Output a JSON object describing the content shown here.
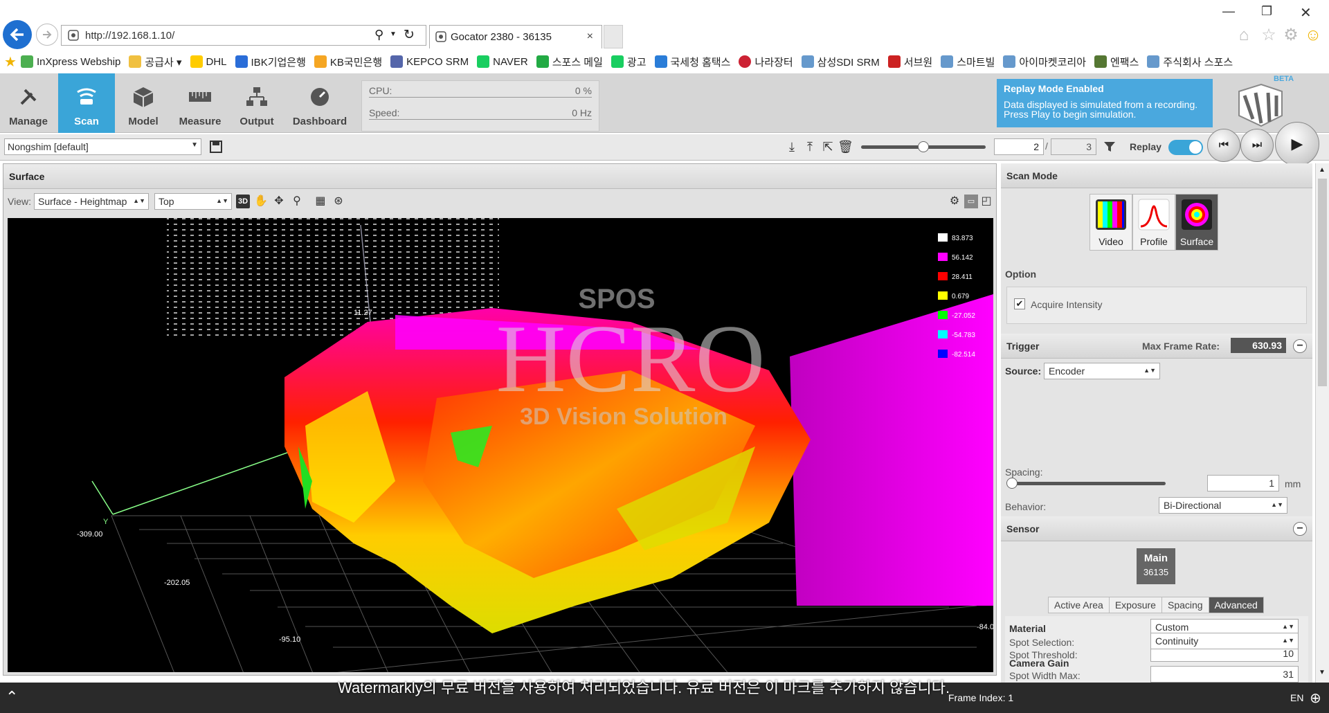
{
  "browser": {
    "url": "http://192.168.1.10/",
    "tab_title": "Gocator 2380 - 36135",
    "tab_close": "×"
  },
  "favorites": [
    {
      "label": "InXpress Webship",
      "color": "#4caf50"
    },
    {
      "label": "공급사 ▾",
      "color": "#f0c040"
    },
    {
      "label": "DHL",
      "color": "#ffcc00"
    },
    {
      "label": "IBK기업은행",
      "color": "#2a6dd8"
    },
    {
      "label": "KB국민은행",
      "color": "#f5a623"
    },
    {
      "label": "KEPCO SRM",
      "color": "#5566aa"
    },
    {
      "label": "NAVER",
      "color": "#19ce60"
    },
    {
      "label": "스포스 메일",
      "color": "#22aa44"
    },
    {
      "label": "광고",
      "color": "#19ce60"
    },
    {
      "label": "국세청 홈택스",
      "color": "#2a7dd8"
    },
    {
      "label": "나라장터",
      "color": "#cc2233"
    },
    {
      "label": "삼성SDI SRM",
      "color": "#6699cc"
    },
    {
      "label": "서브원",
      "color": "#cc2222"
    },
    {
      "label": "스마트빌",
      "color": "#6699cc"
    },
    {
      "label": "아이마켓코리아",
      "color": "#6699cc"
    },
    {
      "label": "엔팩스",
      "color": "#557733"
    },
    {
      "label": "주식회사 스포스",
      "color": "#6699cc"
    }
  ],
  "nav_tabs": [
    {
      "label": "Manage",
      "icon": "wrench-icon"
    },
    {
      "label": "Scan",
      "icon": "scan-icon"
    },
    {
      "label": "Model",
      "icon": "cube-icon"
    },
    {
      "label": "Measure",
      "icon": "ruler-icon"
    },
    {
      "label": "Output",
      "icon": "network-icon"
    },
    {
      "label": "Dashboard",
      "icon": "gauge-icon"
    }
  ],
  "stats": {
    "cpu_label": "CPU:",
    "cpu_value": "0 %",
    "speed_label": "Speed:",
    "speed_value": "0 Hz"
  },
  "replay_note": {
    "title": "Replay Mode Enabled",
    "body": "Data displayed is simulated from a recording. Press Play to begin simulation."
  },
  "logo_beta": "BETA",
  "toolbar": {
    "job": "Nongshim [default]",
    "frame_current": "2",
    "frame_sep": "/",
    "frame_total": "3",
    "replay_label": "Replay",
    "playback_position": 0.5
  },
  "surface": {
    "title": "Surface",
    "view_label": "View:",
    "view_mode": "Surface - Heightmap",
    "view_dir": "Top",
    "legend": [
      {
        "value": "83.873",
        "color": "#ffffff"
      },
      {
        "value": "56.142",
        "color": "#ff00ff"
      },
      {
        "value": "28.411",
        "color": "#ff0000"
      },
      {
        "value": "0.679",
        "color": "#ffff00"
      },
      {
        "value": "-27.052",
        "color": "#00ff00"
      },
      {
        "value": "-54.783",
        "color": "#00ffff"
      },
      {
        "value": "-82.514",
        "color": "#0000ff"
      }
    ],
    "axis_labels": [
      "11.27",
      "Y",
      "-309.00",
      "-202.05",
      "-95.10",
      "-84.0"
    ],
    "overlay": {
      "top": "SPOS",
      "main": "HCRO",
      "sub": "3D Vision Solution"
    }
  },
  "scan_mode": {
    "title": "Scan Mode",
    "modes": [
      "Video",
      "Profile",
      "Surface"
    ],
    "option_title": "Option",
    "acquire_intensity": "Acquire Intensity"
  },
  "trigger": {
    "title": "Trigger",
    "max_rate_label": "Max Frame Rate:",
    "max_rate": "630.93",
    "source_label": "Source:",
    "source": "Encoder",
    "spacing_label": "Spacing:",
    "spacing": "1",
    "spacing_unit": "mm",
    "behavior_label": "Behavior:",
    "behavior": "Bi-Directional"
  },
  "sensor": {
    "title": "Sensor",
    "main_label": "Main",
    "main_id": "36135",
    "tabs": [
      "Active Area",
      "Exposure",
      "Spacing",
      "Advanced"
    ],
    "material_label": "Material",
    "material": "Custom",
    "spot_threshold_label": "Spot Threshold:",
    "spot_threshold": "10",
    "spot_width_label": "Spot Width Max:",
    "spot_width": "31",
    "spot_selection_label": "Spot Selection:",
    "spot_selection": "Continuity",
    "camera_gain_label": "Camera Gain"
  },
  "footer": {
    "watermark": "Watermarkly의 무료 버전을 사용하여 처리되었습니다. 유료 버전은 이 마크를 추가하지 않습니다.",
    "frame_index": "Frame Index: 1",
    "lang": "EN"
  }
}
